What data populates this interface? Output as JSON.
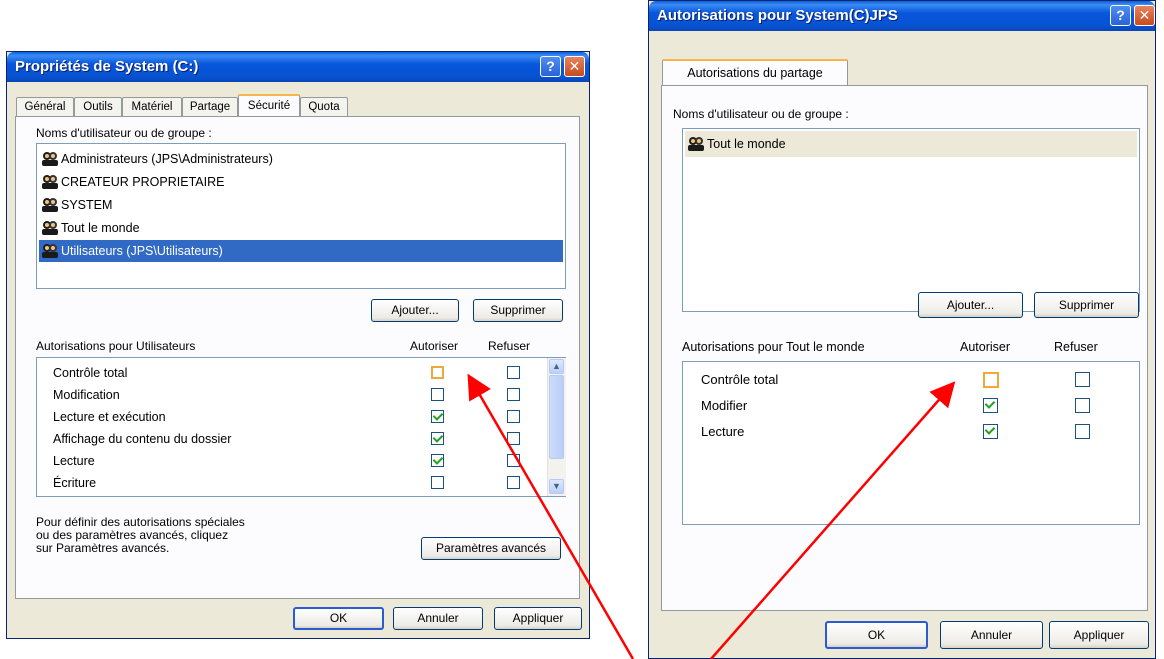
{
  "left_window": {
    "title": "Propriétés de System (C:)",
    "tabs": [
      "Général",
      "Outils",
      "Matériel",
      "Partage",
      "Sécurité",
      "Quota"
    ],
    "active_tab": "Sécurité",
    "users_label": "Noms d'utilisateur ou de groupe :",
    "users": [
      "Administrateurs (JPS\\Administrateurs)",
      "CREATEUR PROPRIETAIRE",
      "SYSTEM",
      "Tout le monde",
      "Utilisateurs (JPS\\Utilisateurs)"
    ],
    "selected_user": "Utilisateurs (JPS\\Utilisateurs)",
    "add_button": "Ajouter...",
    "remove_button": "Supprimer",
    "permissions_label": "Autorisations pour Utilisateurs",
    "allow_header": "Autoriser",
    "deny_header": "Refuser",
    "permissions": [
      {
        "name": "Contrôle total",
        "allow": false,
        "deny": false
      },
      {
        "name": "Modification",
        "allow": false,
        "deny": false
      },
      {
        "name": "Lecture et exécution",
        "allow": true,
        "deny": false
      },
      {
        "name": "Affichage du contenu du dossier",
        "allow": true,
        "deny": false
      },
      {
        "name": "Lecture",
        "allow": true,
        "deny": false
      },
      {
        "name": "Écriture",
        "allow": false,
        "deny": false
      }
    ],
    "advanced_text_1": "Pour définir des autorisations spéciales",
    "advanced_text_2": "ou des paramètres avancés, cliquez",
    "advanced_text_3": "sur Paramètres avancés.",
    "advanced_button": "Paramètres avancés",
    "ok_button": "OK",
    "cancel_button": "Annuler",
    "apply_button": "Appliquer"
  },
  "right_window": {
    "title": "Autorisations pour System(C)JPS",
    "tab": "Autorisations du partage",
    "users_label": "Noms d'utilisateur ou de groupe :",
    "users": [
      "Tout le monde"
    ],
    "add_button": "Ajouter...",
    "remove_button": "Supprimer",
    "permissions_label": "Autorisations pour Tout le monde",
    "allow_header": "Autoriser",
    "deny_header": "Refuser",
    "permissions": [
      {
        "name": "Contrôle total",
        "allow": false,
        "deny": false
      },
      {
        "name": "Modifier",
        "allow": true,
        "deny": false
      },
      {
        "name": "Lecture",
        "allow": true,
        "deny": false
      }
    ],
    "ok_button": "OK",
    "cancel_button": "Annuler",
    "apply_button": "Appliquer"
  },
  "annotation": {
    "arrow_color": "#ff0000"
  },
  "colors": {
    "titlebar": "#0753d3",
    "selection": "#316ac5",
    "dialog_bg": "#ece9d8"
  }
}
